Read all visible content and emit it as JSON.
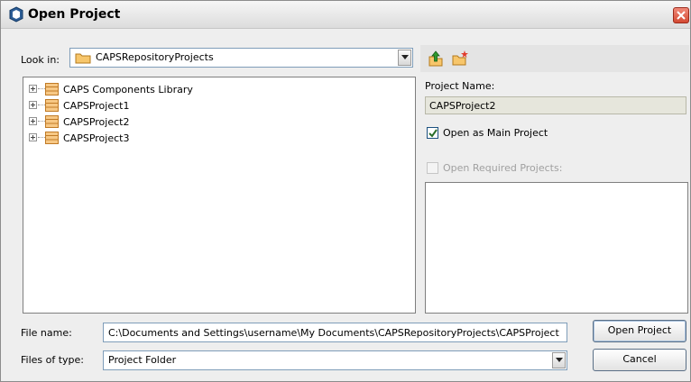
{
  "window": {
    "title": "Open Project"
  },
  "look_in": {
    "label": "Look in:",
    "value": "CAPSRepositoryProjects"
  },
  "toolbar": {
    "icons": [
      "up-folder-icon",
      "new-folder-icon"
    ]
  },
  "tree": {
    "items": [
      {
        "label": "CAPS Components Library"
      },
      {
        "label": "CAPSProject1"
      },
      {
        "label": "CAPSProject2"
      },
      {
        "label": "CAPSProject3"
      }
    ]
  },
  "project": {
    "name_label": "Project Name:",
    "name_value": "CAPSProject2",
    "open_as_main_label": "Open as Main Project",
    "open_as_main_checked": true,
    "open_required_label": "Open Required Projects:",
    "open_required_checked": false,
    "open_required_enabled": false
  },
  "file_name": {
    "label": "File name:",
    "value": "C:\\Documents and Settings\\username\\My Documents\\CAPSRepositoryProjects\\CAPSProject"
  },
  "file_type": {
    "label": "Files of type:",
    "value": "Project Folder"
  },
  "buttons": {
    "open": "Open Project",
    "cancel": "Cancel"
  },
  "colors": {
    "folder": "#f2a94a",
    "checkbox_mark": "#2a6e2a",
    "close": "#d44a33"
  }
}
